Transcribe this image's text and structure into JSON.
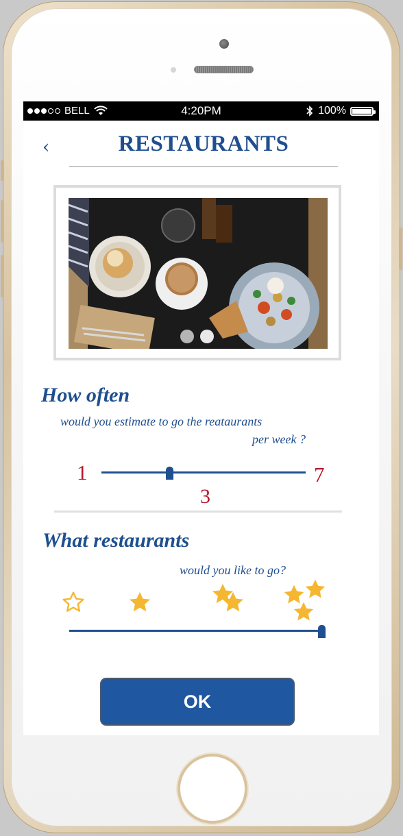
{
  "status_bar": {
    "carrier": "BELL",
    "time": "4:20PM",
    "battery": "100%",
    "signal_icon": "signal-dots-icon",
    "wifi_icon": "wifi-icon",
    "bluetooth_icon": "bluetooth-icon",
    "battery_icon": "battery-icon"
  },
  "header": {
    "back_label": "‹",
    "title": "RESTAURANTS"
  },
  "carousel": {
    "image": "restaurant-food-photo",
    "page_count": 2,
    "current_page": 1
  },
  "frequency": {
    "heading": "How often",
    "subtitle_line1": "would you estimate to go the reataurants",
    "subtitle_line2": "per week ?",
    "min_label": "1",
    "max_label": "7",
    "min": 1,
    "max": 7,
    "value": 3,
    "value_label": "3"
  },
  "restaurant_type": {
    "heading": "What restaurants",
    "subtitle": "would you like to go?",
    "levels": [
      {
        "name": "no-star",
        "icon": "star-outline-icon"
      },
      {
        "name": "one-star",
        "icon": "star-icon"
      },
      {
        "name": "two-star",
        "icon": "two-stars-icon"
      },
      {
        "name": "three-star",
        "icon": "three-stars-icon"
      }
    ],
    "selected_level": 3,
    "star_color": "#f5b731"
  },
  "ok_button": {
    "label": "OK"
  },
  "colors": {
    "primary_blue": "#1f4f8e",
    "accent_red": "#b5172f",
    "button_blue": "#1f57a0"
  }
}
